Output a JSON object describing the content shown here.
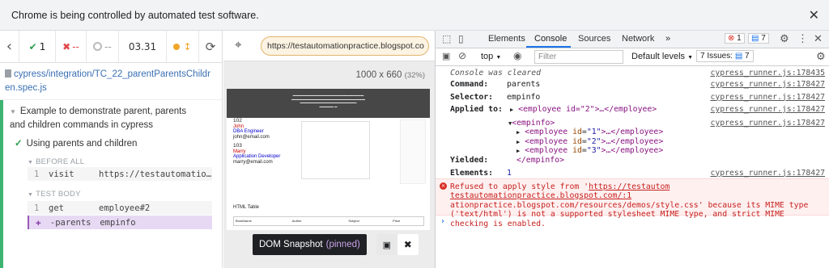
{
  "infobar": {
    "message": "Chrome is being controlled by automated test software.",
    "close": "✕"
  },
  "reporter": {
    "back": "‹",
    "passed": "1",
    "failed": "--",
    "pending": "--",
    "duration": "03.31",
    "spec_path": "cypress/integration/TC_22_parentParentsChildren.spec.js",
    "suite_title": "Example to demonstrate parent, parents and children commands in cypress",
    "test_title": "Using parents and children",
    "before_all_label": "BEFORE ALL",
    "test_body_label": "TEST BODY",
    "commands": [
      {
        "num": "1",
        "name": "visit",
        "message": "https://testautomation…"
      },
      {
        "num": "1",
        "name": "get",
        "message": "employee#2"
      },
      {
        "num": "",
        "name": "-parents",
        "message": "empinfo"
      }
    ]
  },
  "aut": {
    "url": "https://testautomationpractice.blogspot.co",
    "size": "1000 x 660",
    "scale": "(32%)",
    "snapshot_label": "DOM Snapshot",
    "snapshot_state": "(pinned)",
    "preview": {
      "emp1_id": "102",
      "emp1_name": "John",
      "emp1_role": "DBA Engineer",
      "emp1_email": "john@email.com",
      "emp2_id": "103",
      "emp2_name": "Marry",
      "emp2_role": "Application Developer",
      "emp2_email": "marry@email.com",
      "table_title": "HTML Table",
      "col1": "BookName",
      "col2": "Author",
      "col3": "Subject",
      "col4": "Price"
    }
  },
  "devtools": {
    "tabs": [
      "Elements",
      "Console",
      "Sources",
      "Network",
      "»"
    ],
    "errors": "1",
    "messages": "7",
    "context": "top",
    "filter_placeholder": "Filter",
    "levels": "Default levels",
    "issues_label": "7 Issues:",
    "issues_count": "7",
    "log": {
      "cleared": "Console was cleared",
      "command_key": "Command:",
      "command_val": "parents",
      "selector_key": "Selector:",
      "selector_val": "empinfo",
      "applied_key": "Applied to:",
      "yielded_key": "Yielded:",
      "elements_key": "Elements:",
      "elements_val": "1",
      "src1": "cypress_runner.js:178435",
      "src2": "cypress_runner.js:178427",
      "error_prefix": "Refused to apply style from '",
      "error_url1": "https://testautom",
      "error_url2": "testautomationpractice.blogspot.com/:1",
      "error_body": "ationpractice.blogspot.com/resources/demos/style.css' because its MIME type ('text/html') is not a supported stylesheet MIME type, and strict MIME checking is enabled."
    },
    "tree": {
      "applied": "<employee id=\"2\">…</employee>",
      "open": "<empinfo>",
      "children": [
        "1",
        "2",
        "3"
      ],
      "close": "</empinfo>"
    }
  }
}
